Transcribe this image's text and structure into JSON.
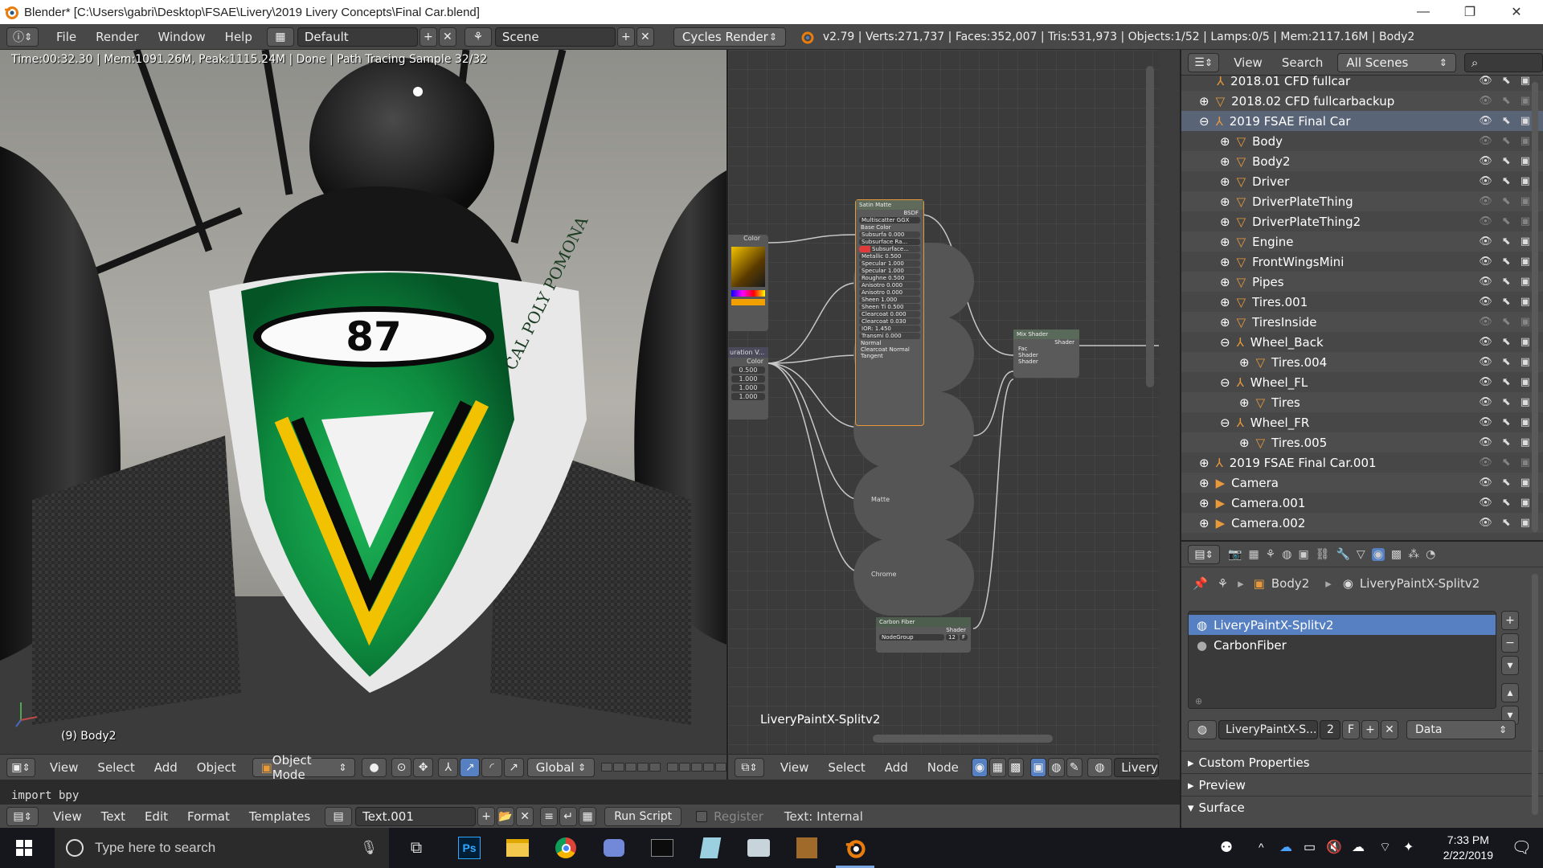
{
  "window": {
    "title": "Blender* [C:\\Users\\gabri\\Desktop\\FSAE\\Livery\\2019 Livery Concepts\\Final Car.blend]",
    "minimize": "—",
    "restore": "❐",
    "close": "✕"
  },
  "info_header": {
    "menus": [
      "File",
      "Render",
      "Window",
      "Help"
    ],
    "layout": "Default",
    "scene": "Scene",
    "engine": "Cycles Render",
    "stats": "v2.79 | Verts:271,737 | Faces:352,007 | Tris:531,973 | Objects:1/52 | Lamps:0/5 | Mem:2117.16M | Body2"
  },
  "viewport": {
    "render_stats": "Time:00:32.30 | Mem:1091.26M, Peak:1115.24M | Done | Path Tracing Sample 32/32",
    "object_label": "(9) Body2",
    "car_number": "87",
    "side_text": "CAL POLY POMONA",
    "header": {
      "menus": [
        "View",
        "Select",
        "Add",
        "Object"
      ],
      "mode": "Object Mode",
      "orientation": "Global"
    }
  },
  "node_editor": {
    "material_label": "LiveryPaintX-Splitv2",
    "bsdf": {
      "title": "Satin Matte",
      "out": "BSDF",
      "dist": "Multiscatter GGX",
      "rows": [
        "Base Color",
        "Subsurfa 0.000",
        "Subsurface Ra...",
        "Subsurface...",
        "Metallic 0.500",
        "Specular 1.000",
        "Specular 1.000",
        "Roughne 0.500",
        "Anisotro 0.000",
        "Anisotro 0.000",
        "Sheen 1.000",
        "Sheen Ti 0.500",
        "Clearcoat 0.000",
        "Clearcoat 0.030",
        "IOR: 1.450",
        "Transmi 0.000",
        "Normal",
        "Clearcoat Normal",
        "Tangent"
      ]
    },
    "color_node": {
      "title": "Color"
    },
    "sat_node": {
      "title": "uration V...",
      "out": "Color",
      "vals": [
        "0.500",
        "1.000",
        "1.000",
        "1.000"
      ]
    },
    "matte_label": "Matte",
    "chrome_label": "Chrome",
    "mix": {
      "title": "Mix Shader",
      "out": "Shader",
      "ins": [
        "Fac",
        "Shader",
        "Shader"
      ]
    },
    "carbon": {
      "title": "Carbon Fiber",
      "out": "Shader",
      "group": "NodeGroup",
      "users": "12",
      "f": "F"
    },
    "header": {
      "menus": [
        "View",
        "Select",
        "Add",
        "Node"
      ],
      "material": "LiveryPai"
    }
  },
  "outliner": {
    "menus": [
      "View",
      "Search"
    ],
    "filter": "All Scenes",
    "rows": [
      {
        "label": "2018.01 CFD fullcar",
        "indent": 0,
        "type": "empty"
      },
      {
        "label": "2018.02 CFD fullcarbackup",
        "indent": 0,
        "type": "mesh"
      },
      {
        "label": "2019 FSAE Final Car",
        "indent": 0,
        "type": "empty"
      },
      {
        "label": "Body",
        "indent": 1,
        "type": "mesh"
      },
      {
        "label": "Body2",
        "indent": 1,
        "type": "mesh"
      },
      {
        "label": "Driver",
        "indent": 1,
        "type": "mesh"
      },
      {
        "label": "DriverPlateThing",
        "indent": 1,
        "type": "mesh"
      },
      {
        "label": "DriverPlateThing2",
        "indent": 1,
        "type": "mesh"
      },
      {
        "label": "Engine",
        "indent": 1,
        "type": "mesh"
      },
      {
        "label": "FrontWingsMini",
        "indent": 1,
        "type": "mesh"
      },
      {
        "label": "Pipes",
        "indent": 1,
        "type": "mesh"
      },
      {
        "label": "Tires.001",
        "indent": 1,
        "type": "mesh"
      },
      {
        "label": "TiresInside",
        "indent": 1,
        "type": "mesh"
      },
      {
        "label": "Wheel_Back",
        "indent": 1,
        "type": "empty"
      },
      {
        "label": "Tires.004",
        "indent": 2,
        "type": "mesh"
      },
      {
        "label": "Wheel_FL",
        "indent": 1,
        "type": "empty"
      },
      {
        "label": "Tires",
        "indent": 2,
        "type": "mesh"
      },
      {
        "label": "Wheel_FR",
        "indent": 1,
        "type": "empty"
      },
      {
        "label": "Tires.005",
        "indent": 2,
        "type": "mesh"
      },
      {
        "label": "2019 FSAE Final Car.001",
        "indent": 0,
        "type": "empty"
      },
      {
        "label": "Camera",
        "indent": 0,
        "type": "camera"
      },
      {
        "label": "Camera.001",
        "indent": 0,
        "type": "camera"
      },
      {
        "label": "Camera.002",
        "indent": 0,
        "type": "camera"
      }
    ]
  },
  "properties": {
    "breadcrumb": [
      "Body2",
      "LiveryPaintX-Splitv2"
    ],
    "slots": [
      "LiveryPaintX-Splitv2",
      "CarbonFiber"
    ],
    "material_field": "LiveryPaintX-S...",
    "users": "2",
    "fake": "F",
    "link": "Data",
    "panels": [
      "Custom Properties",
      "Preview",
      "Surface"
    ]
  },
  "text_editor": {
    "console_text": "import bpy",
    "menus": [
      "View",
      "Text",
      "Edit",
      "Format",
      "Templates"
    ],
    "text_name": "Text.001",
    "run_script": "Run Script",
    "register": "Register",
    "status": "Text: Internal"
  },
  "taskbar": {
    "search_placeholder": "Type here to search",
    "time": "7:33 PM",
    "date": "2/22/2019"
  },
  "colors": {
    "blender_orange": "#e87d0d",
    "selection_blue": "#5680c2",
    "livery_green": "#0d8a3e",
    "livery_yellow": "#f2c200"
  }
}
